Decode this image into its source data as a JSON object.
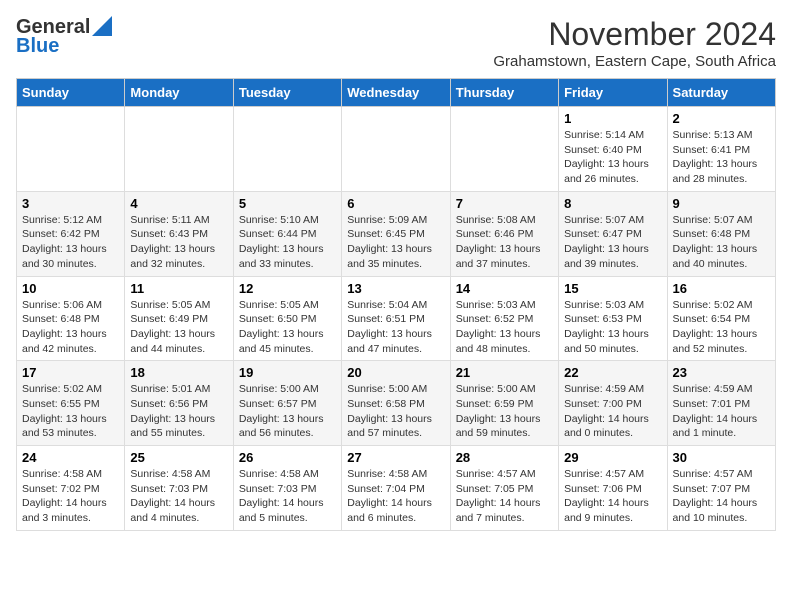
{
  "logo": {
    "general": "General",
    "blue": "Blue"
  },
  "title": "November 2024",
  "location": "Grahamstown, Eastern Cape, South Africa",
  "days_header": [
    "Sunday",
    "Monday",
    "Tuesday",
    "Wednesday",
    "Thursday",
    "Friday",
    "Saturday"
  ],
  "weeks": [
    [
      {
        "day": "",
        "info": ""
      },
      {
        "day": "",
        "info": ""
      },
      {
        "day": "",
        "info": ""
      },
      {
        "day": "",
        "info": ""
      },
      {
        "day": "",
        "info": ""
      },
      {
        "day": "1",
        "info": "Sunrise: 5:14 AM\nSunset: 6:40 PM\nDaylight: 13 hours\nand 26 minutes."
      },
      {
        "day": "2",
        "info": "Sunrise: 5:13 AM\nSunset: 6:41 PM\nDaylight: 13 hours\nand 28 minutes."
      }
    ],
    [
      {
        "day": "3",
        "info": "Sunrise: 5:12 AM\nSunset: 6:42 PM\nDaylight: 13 hours\nand 30 minutes."
      },
      {
        "day": "4",
        "info": "Sunrise: 5:11 AM\nSunset: 6:43 PM\nDaylight: 13 hours\nand 32 minutes."
      },
      {
        "day": "5",
        "info": "Sunrise: 5:10 AM\nSunset: 6:44 PM\nDaylight: 13 hours\nand 33 minutes."
      },
      {
        "day": "6",
        "info": "Sunrise: 5:09 AM\nSunset: 6:45 PM\nDaylight: 13 hours\nand 35 minutes."
      },
      {
        "day": "7",
        "info": "Sunrise: 5:08 AM\nSunset: 6:46 PM\nDaylight: 13 hours\nand 37 minutes."
      },
      {
        "day": "8",
        "info": "Sunrise: 5:07 AM\nSunset: 6:47 PM\nDaylight: 13 hours\nand 39 minutes."
      },
      {
        "day": "9",
        "info": "Sunrise: 5:07 AM\nSunset: 6:48 PM\nDaylight: 13 hours\nand 40 minutes."
      }
    ],
    [
      {
        "day": "10",
        "info": "Sunrise: 5:06 AM\nSunset: 6:48 PM\nDaylight: 13 hours\nand 42 minutes."
      },
      {
        "day": "11",
        "info": "Sunrise: 5:05 AM\nSunset: 6:49 PM\nDaylight: 13 hours\nand 44 minutes."
      },
      {
        "day": "12",
        "info": "Sunrise: 5:05 AM\nSunset: 6:50 PM\nDaylight: 13 hours\nand 45 minutes."
      },
      {
        "day": "13",
        "info": "Sunrise: 5:04 AM\nSunset: 6:51 PM\nDaylight: 13 hours\nand 47 minutes."
      },
      {
        "day": "14",
        "info": "Sunrise: 5:03 AM\nSunset: 6:52 PM\nDaylight: 13 hours\nand 48 minutes."
      },
      {
        "day": "15",
        "info": "Sunrise: 5:03 AM\nSunset: 6:53 PM\nDaylight: 13 hours\nand 50 minutes."
      },
      {
        "day": "16",
        "info": "Sunrise: 5:02 AM\nSunset: 6:54 PM\nDaylight: 13 hours\nand 52 minutes."
      }
    ],
    [
      {
        "day": "17",
        "info": "Sunrise: 5:02 AM\nSunset: 6:55 PM\nDaylight: 13 hours\nand 53 minutes."
      },
      {
        "day": "18",
        "info": "Sunrise: 5:01 AM\nSunset: 6:56 PM\nDaylight: 13 hours\nand 55 minutes."
      },
      {
        "day": "19",
        "info": "Sunrise: 5:00 AM\nSunset: 6:57 PM\nDaylight: 13 hours\nand 56 minutes."
      },
      {
        "day": "20",
        "info": "Sunrise: 5:00 AM\nSunset: 6:58 PM\nDaylight: 13 hours\nand 57 minutes."
      },
      {
        "day": "21",
        "info": "Sunrise: 5:00 AM\nSunset: 6:59 PM\nDaylight: 13 hours\nand 59 minutes."
      },
      {
        "day": "22",
        "info": "Sunrise: 4:59 AM\nSunset: 7:00 PM\nDaylight: 14 hours\nand 0 minutes."
      },
      {
        "day": "23",
        "info": "Sunrise: 4:59 AM\nSunset: 7:01 PM\nDaylight: 14 hours\nand 1 minute."
      }
    ],
    [
      {
        "day": "24",
        "info": "Sunrise: 4:58 AM\nSunset: 7:02 PM\nDaylight: 14 hours\nand 3 minutes."
      },
      {
        "day": "25",
        "info": "Sunrise: 4:58 AM\nSunset: 7:03 PM\nDaylight: 14 hours\nand 4 minutes."
      },
      {
        "day": "26",
        "info": "Sunrise: 4:58 AM\nSunset: 7:03 PM\nDaylight: 14 hours\nand 5 minutes."
      },
      {
        "day": "27",
        "info": "Sunrise: 4:58 AM\nSunset: 7:04 PM\nDaylight: 14 hours\nand 6 minutes."
      },
      {
        "day": "28",
        "info": "Sunrise: 4:57 AM\nSunset: 7:05 PM\nDaylight: 14 hours\nand 7 minutes."
      },
      {
        "day": "29",
        "info": "Sunrise: 4:57 AM\nSunset: 7:06 PM\nDaylight: 14 hours\nand 9 minutes."
      },
      {
        "day": "30",
        "info": "Sunrise: 4:57 AM\nSunset: 7:07 PM\nDaylight: 14 hours\nand 10 minutes."
      }
    ]
  ]
}
